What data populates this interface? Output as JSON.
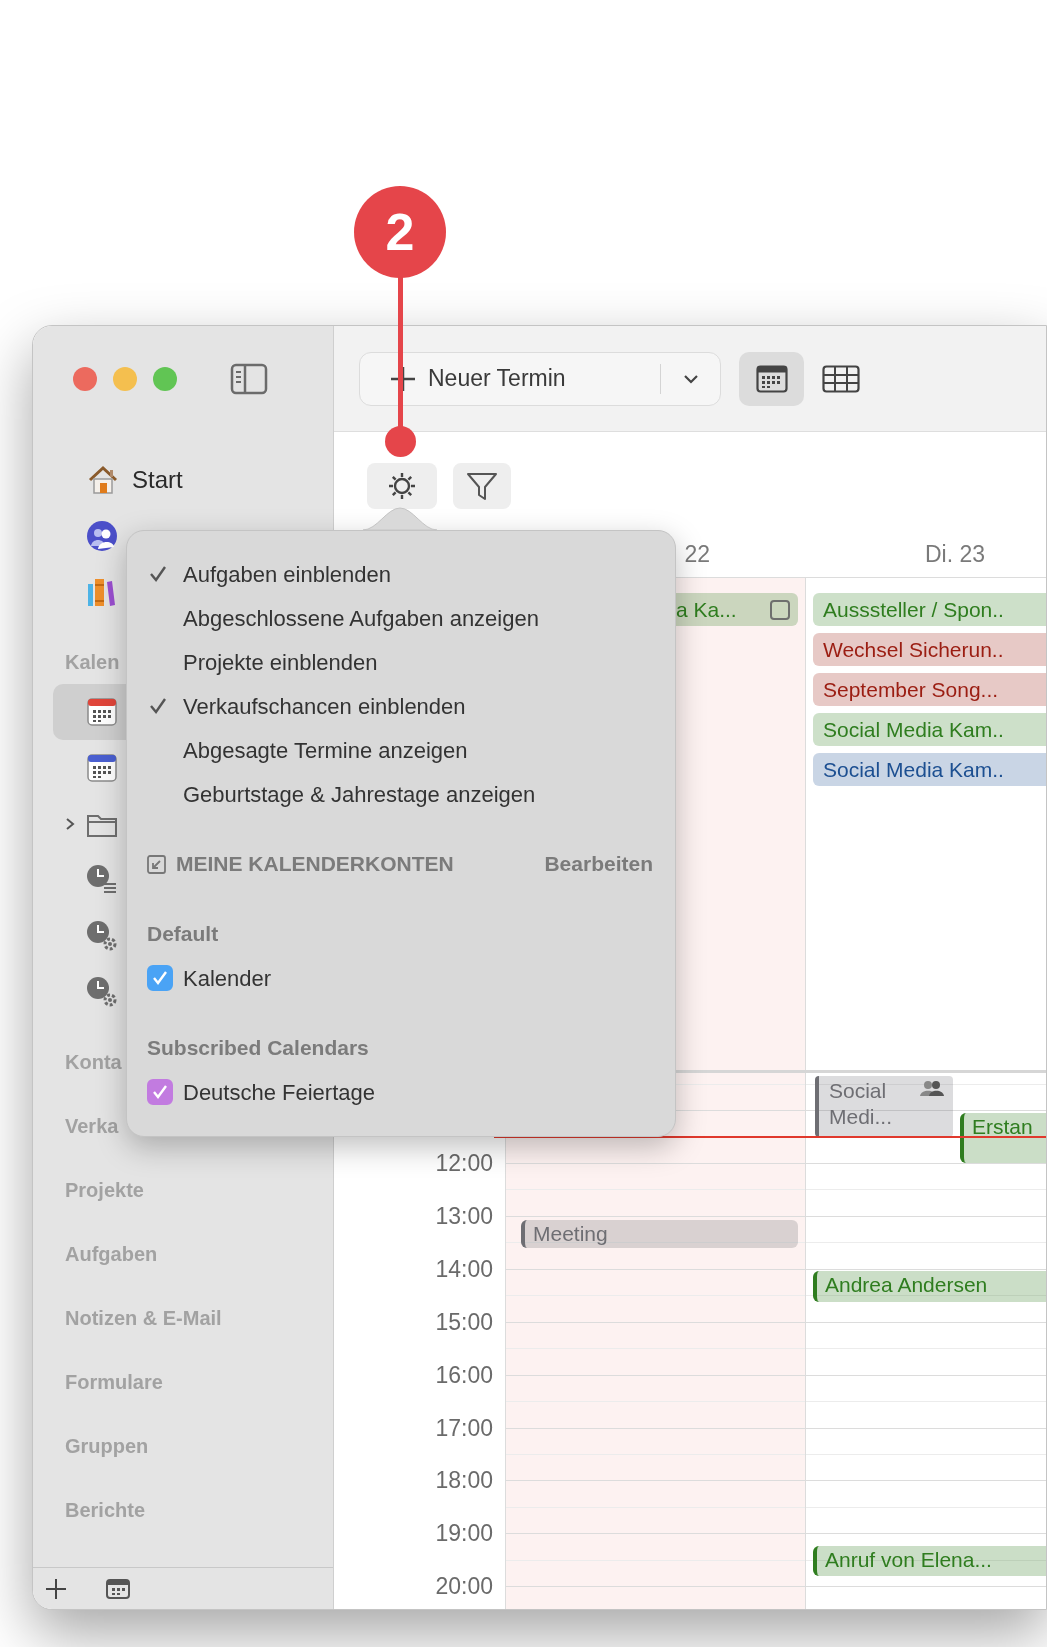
{
  "callout": {
    "number": "2"
  },
  "sidebar": {
    "top_items": [
      {
        "kind": "home",
        "label": "Start",
        "selected": false
      },
      {
        "kind": "contacts",
        "selected": false
      },
      {
        "kind": "library",
        "selected": false
      }
    ],
    "sections": [
      {
        "title": "Kalen",
        "items": [
          {
            "kind": "calendar",
            "color": "#e0453a",
            "selected": true
          },
          {
            "kind": "calendar",
            "color": "#4a5fd0",
            "selected": false
          },
          {
            "kind": "folder",
            "selected": false,
            "expanded": false
          },
          {
            "kind": "timeline",
            "selected": false
          },
          {
            "kind": "automation",
            "selected": false
          },
          {
            "kind": "automation",
            "selected": false
          }
        ]
      },
      {
        "title": "Konta"
      },
      {
        "title": "Verka"
      },
      {
        "title": "Projekte"
      },
      {
        "title": "Aufgaben"
      },
      {
        "title": "Notizen & E-Mail"
      },
      {
        "title": "Formulare"
      },
      {
        "title": "Gruppen"
      },
      {
        "title": "Berichte"
      }
    ]
  },
  "toolbar": {
    "new_button": {
      "label": "Neuer Termin"
    },
    "views": [
      {
        "kind": "day",
        "selected": true
      },
      {
        "kind": "month",
        "selected": false
      }
    ]
  },
  "calendar": {
    "days": [
      {
        "label": "22",
        "shaded": true,
        "all_day": [
          {
            "kind": "task",
            "title": "a Ka...",
            "done": false,
            "color": "#2f7d1f"
          }
        ],
        "events": [
          {
            "kind": "event",
            "title": "Meeting",
            "color": "#6e6e73"
          }
        ]
      },
      {
        "label": "Di. 23",
        "shaded": false,
        "all_day": [
          {
            "kind": "event",
            "title": "Ausssteller / Spon..",
            "color": "#2f7d1f"
          },
          {
            "kind": "event",
            "title": "Wechsel Sicherun..",
            "color": "#9b1d12"
          },
          {
            "kind": "event",
            "title": "September Song...",
            "color": "#9b1d12"
          },
          {
            "kind": "event",
            "title": "Social Media Kam..",
            "color": "#2f7d1f"
          },
          {
            "kind": "event",
            "title": "Social Media Kam..",
            "color": "#1c4f91"
          }
        ],
        "events": [
          {
            "kind": "shared",
            "title": "Social Medi...",
            "color": "#6e6e73"
          },
          {
            "kind": "event",
            "title": "Erstan",
            "color": "#2f7d1f"
          },
          {
            "kind": "event",
            "title": "Andrea Andersen",
            "color": "#2f7d1f"
          },
          {
            "kind": "event",
            "title": "Anruf von Elena...",
            "color": "#2f7d1f"
          }
        ]
      }
    ],
    "times": [
      "12:00",
      "13:00",
      "14:00",
      "15:00",
      "16:00",
      "17:00",
      "18:00",
      "19:00",
      "20:00"
    ]
  },
  "popover": {
    "options": [
      {
        "label": "Aufgaben einblenden",
        "checked": true
      },
      {
        "label": "Abgeschlossene Aufgaben anzeigen",
        "checked": false
      },
      {
        "label": "Projekte einblenden",
        "checked": false
      },
      {
        "label": "Verkaufschancen einblenden",
        "checked": true
      },
      {
        "label": "Abgesagte Termine anzeigen",
        "checked": false
      },
      {
        "label": "Geburtstage & Jahrestage anzeigen",
        "checked": false
      }
    ],
    "accounts": {
      "title": "MEINE KALENDERKONTEN",
      "action": "Bearbeiten"
    },
    "groups": [
      {
        "title": "Default",
        "calendars": [
          {
            "label": "Kalender",
            "checked": true,
            "color": "#4aa3f5"
          }
        ]
      },
      {
        "title": "Subscribed Calendars",
        "calendars": [
          {
            "label": "Deutsche Feiertage",
            "checked": true,
            "color": "#c27be0"
          }
        ]
      }
    ]
  }
}
